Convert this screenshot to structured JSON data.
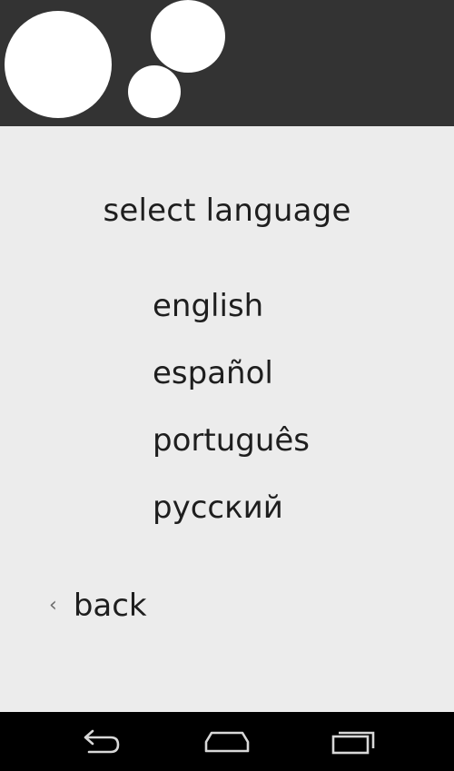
{
  "header": {
    "logo_icon": "three-circles-logo-icon"
  },
  "main": {
    "title": "select language",
    "languages": [
      {
        "label": "english"
      },
      {
        "label": "español"
      },
      {
        "label": "português"
      },
      {
        "label": "русский"
      }
    ],
    "back_label": "back",
    "back_icon": "chevron-left-icon"
  },
  "navbar": {
    "back_icon": "nav-back-icon",
    "home_icon": "nav-home-icon",
    "recents_icon": "nav-recents-icon"
  },
  "colors": {
    "header_bg": "#333333",
    "content_bg": "#ececec",
    "navbar_bg": "#000000",
    "text": "#1e1e1e"
  }
}
